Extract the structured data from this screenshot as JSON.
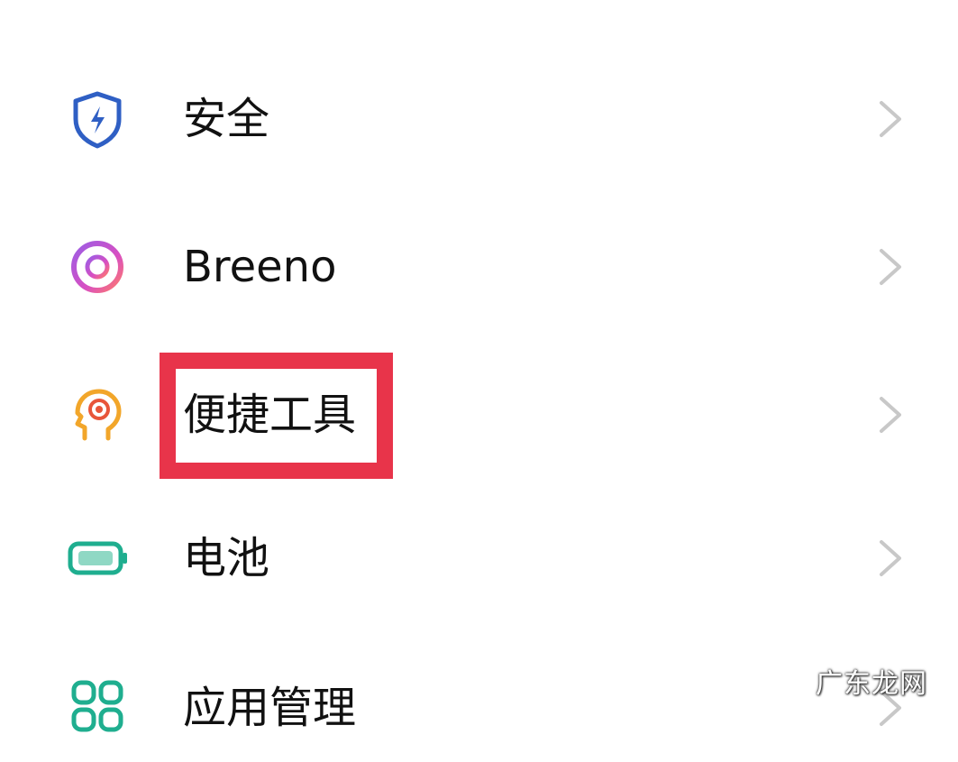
{
  "settings": {
    "items": [
      {
        "label": "安全",
        "icon": "shield-bolt-icon",
        "color": "#2f5fc4"
      },
      {
        "label": "Breeno",
        "icon": "breeno-ring-icon",
        "color": "#c04fd0"
      },
      {
        "label": "便捷工具",
        "icon": "head-target-icon",
        "color": "#f0a020"
      },
      {
        "label": "电池",
        "icon": "battery-icon",
        "color": "#1fae8f"
      },
      {
        "label": "应用管理",
        "icon": "app-grid-icon",
        "color": "#1fae8f"
      }
    ]
  },
  "highlight": {
    "color": "#e8344a"
  },
  "watermark": {
    "text": "广东龙网"
  }
}
